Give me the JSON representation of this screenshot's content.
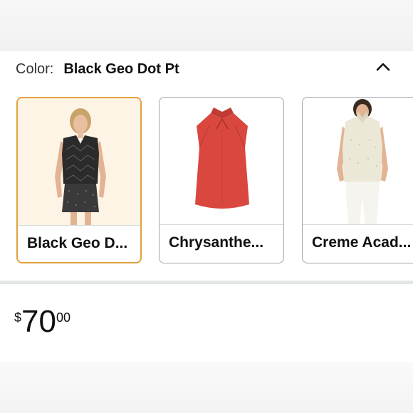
{
  "color_selector": {
    "label": "Color:",
    "selected_value": "Black Geo Dot Pt",
    "collapse_icon": "chevron-up-icon",
    "swatches": [
      {
        "name": "Black Geo D...",
        "selected": true,
        "garment_color": "#2b2b2b"
      },
      {
        "name": "Chrysanthe...",
        "selected": false,
        "garment_color": "#d9473f"
      },
      {
        "name": "Creme Acad...",
        "selected": false,
        "garment_color": "#ece8d8"
      }
    ]
  },
  "price": {
    "currency_symbol": "$",
    "whole": "70",
    "fraction": "00"
  },
  "colors": {
    "selected_border": "#e1a13f",
    "selected_background": "#fef4e6",
    "border": "#a2a6ac"
  }
}
